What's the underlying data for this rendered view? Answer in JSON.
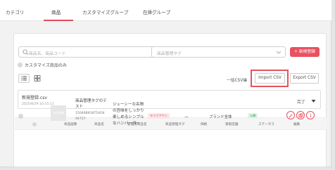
{
  "tabs": [
    {
      "label": "カテゴリ",
      "active": false
    },
    {
      "label": "商品",
      "active": true
    },
    {
      "label": "カスタマイズグループ",
      "active": false
    },
    {
      "label": "在庫グループ",
      "active": false
    }
  ],
  "filters": {
    "search_placeholder": "商品名、商品コード",
    "tag_placeholder": "商品管理タグ",
    "new_button": "+ 新規登録",
    "custom_only_label": "カスタマイズ商品のみ"
  },
  "toolbar": {
    "bulk_label": "一括CSV操",
    "import_label": "Import CSV",
    "export_label": "Export CSV"
  },
  "upload": {
    "file_name": "新規登録.csv",
    "timestamp": "2025/6/29 10:15:11",
    "status": "完了"
  },
  "table": {
    "headers": [
      "商品画像",
      "商品名",
      "管理用商品名",
      "商品管理タグ",
      "価格",
      "受取店舗",
      "ステータス",
      "編集"
    ],
    "rows": [
      {
        "image_label": "商品画像",
        "name_line1": "商品管理タグのテ",
        "name_line2": "スト",
        "code_line1": "150468918754O4",
        "code_line2": "94737",
        "desc_line1": "ジューシーな名物",
        "desc_line2": "の旨味をしっかり",
        "desc_line3": "楽しめるシンプル",
        "desc_line4": "なハンバーガー",
        "tag": "テイクアウト",
        "price": "ー",
        "store": "ブランド全体",
        "status": "公開"
      }
    ]
  },
  "colors": {
    "accent": "#e8515f",
    "tag_bg": "#fde6e9",
    "published": "#2f9b4d"
  },
  "icons": [
    "search-icon",
    "chevron-down-icon",
    "list-view-icon",
    "grid-view-icon",
    "caret-down-icon",
    "edit-icon",
    "copy-icon",
    "info-icon"
  ]
}
